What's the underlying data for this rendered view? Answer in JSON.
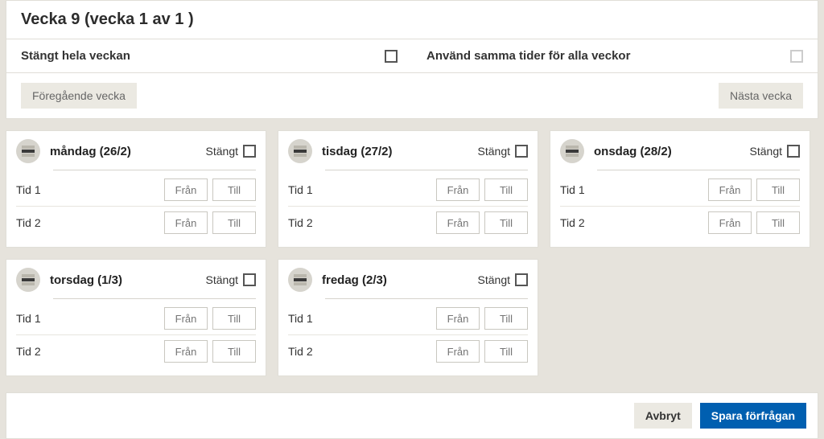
{
  "title": "Vecka 9 (vecka 1 av 1 )",
  "options": {
    "closedWeek": {
      "label": "Stängt hela veckan"
    },
    "sameTimes": {
      "label": "Använd samma tider för alla veckor"
    }
  },
  "nav": {
    "prev": "Föregående vecka",
    "next": "Nästa vecka"
  },
  "days": [
    {
      "name": "måndag (26/2)",
      "closedLabel": "Stängt",
      "rows": [
        "Tid 1",
        "Tid 2"
      ]
    },
    {
      "name": "tisdag (27/2)",
      "closedLabel": "Stängt",
      "rows": [
        "Tid 1",
        "Tid 2"
      ]
    },
    {
      "name": "onsdag (28/2)",
      "closedLabel": "Stängt",
      "rows": [
        "Tid 1",
        "Tid 2"
      ]
    },
    {
      "name": "torsdag (1/3)",
      "closedLabel": "Stängt",
      "rows": [
        "Tid 1",
        "Tid 2"
      ]
    },
    {
      "name": "fredag (2/3)",
      "closedLabel": "Stängt",
      "rows": [
        "Tid 1",
        "Tid 2"
      ]
    }
  ],
  "timeInput": {
    "from": "Från",
    "to": "Till"
  },
  "footer": {
    "cancel": "Avbryt",
    "submit": "Spara förfrågan"
  }
}
